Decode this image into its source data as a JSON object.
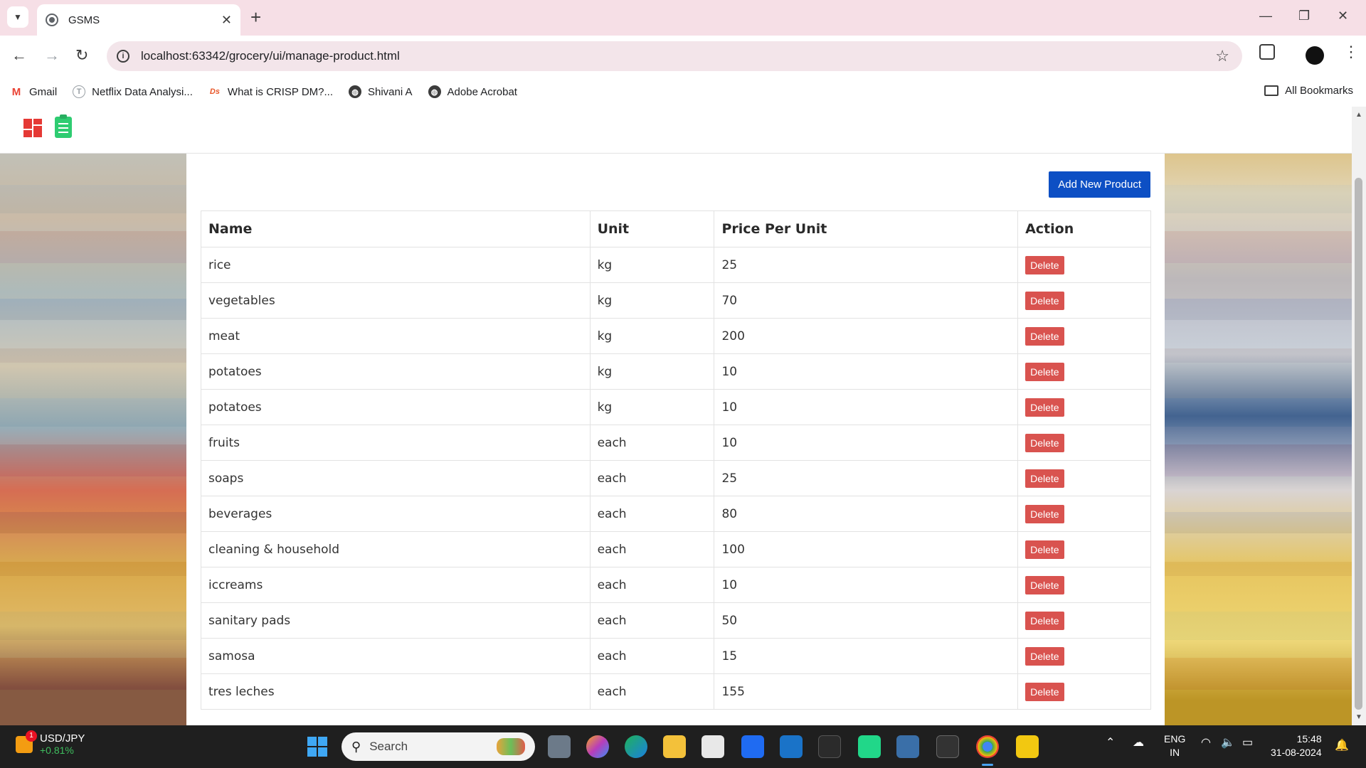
{
  "browser": {
    "tab_title": "GSMS",
    "url": "localhost:63342/grocery/ui/manage-product.html",
    "bookmarks": [
      {
        "label": "Gmail",
        "icon": "gmail-icon"
      },
      {
        "label": "Netflix Data Analysi...",
        "icon": "t-icon"
      },
      {
        "label": "What is CRISP DM?...",
        "icon": "ds-icon"
      },
      {
        "label": "Shivani A",
        "icon": "globe-icon"
      },
      {
        "label": "Adobe Acrobat",
        "icon": "globe-icon"
      }
    ],
    "all_bookmarks": "All Bookmarks"
  },
  "page": {
    "add_button": "Add New Product",
    "columns": {
      "name": "Name",
      "unit": "Unit",
      "price": "Price Per Unit",
      "action": "Action"
    },
    "delete_label": "Delete",
    "products": [
      {
        "name": "rice",
        "unit": "kg",
        "price": "25"
      },
      {
        "name": "vegetables",
        "unit": "kg",
        "price": "70"
      },
      {
        "name": "meat",
        "unit": "kg",
        "price": "200"
      },
      {
        "name": "potatoes",
        "unit": "kg",
        "price": "10"
      },
      {
        "name": "potatoes",
        "unit": "kg",
        "price": "10"
      },
      {
        "name": "fruits",
        "unit": "each",
        "price": "10"
      },
      {
        "name": "soaps",
        "unit": "each",
        "price": "25"
      },
      {
        "name": "beverages",
        "unit": "each",
        "price": "80"
      },
      {
        "name": "cleaning & household",
        "unit": "each",
        "price": "100"
      },
      {
        "name": "iccreams",
        "unit": "each",
        "price": "10"
      },
      {
        "name": "sanitary pads",
        "unit": "each",
        "price": "50"
      },
      {
        "name": "samosa",
        "unit": "each",
        "price": "15"
      },
      {
        "name": "tres leches",
        "unit": "each",
        "price": "155"
      }
    ]
  },
  "taskbar": {
    "stock_name": "USD/JPY",
    "stock_change": "+0.81%",
    "stock_badge": "1",
    "search_label": "Search",
    "lang_line1": "ENG",
    "lang_line2": "IN",
    "time": "15:48",
    "date": "31-08-2024"
  },
  "colors": {
    "accent_button": "#0d4fc4",
    "delete_button": "#d9534f",
    "chrome_frame": "#f6dfe6"
  }
}
